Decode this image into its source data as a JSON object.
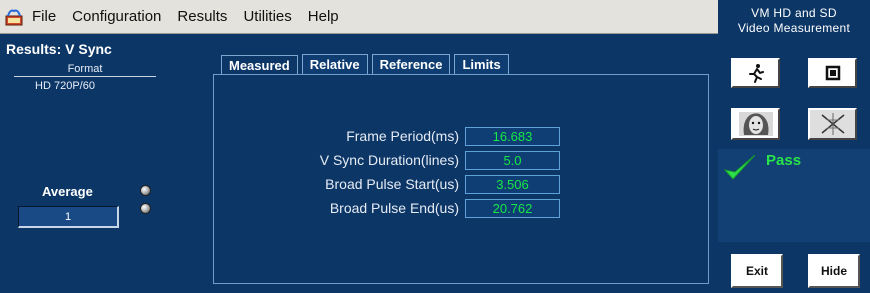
{
  "menu": {
    "app_icon": "application-icon",
    "items": [
      "File",
      "Configuration",
      "Results",
      "Utilities",
      "Help"
    ]
  },
  "app_title": {
    "line1": "VM HD and SD",
    "line2": "Video Measurement"
  },
  "left": {
    "title": "Results: V Sync",
    "format_label": "Format",
    "format_value": "HD 720P/60",
    "average_label": "Average",
    "average_value": "1"
  },
  "tabs": [
    {
      "label": "Measured",
      "active": true
    },
    {
      "label": "Relative",
      "active": false
    },
    {
      "label": "Reference",
      "active": false
    },
    {
      "label": "Limits",
      "active": false
    }
  ],
  "measurements": [
    {
      "label": "Frame Period(ms)",
      "value": "16.683"
    },
    {
      "label": "V Sync Duration(lines)",
      "value": "5.0"
    },
    {
      "label": "Broad Pulse Start(us)",
      "value": "3.506"
    },
    {
      "label": "Broad Pulse End(us)",
      "value": "20.762"
    }
  ],
  "right_buttons": {
    "run_icon": "running-man-icon",
    "stop_icon": "stop-square-icon",
    "face_icon": "face-image-icon",
    "pattern_icon": "cross-pattern-icon"
  },
  "status": {
    "icon": "checkmark-icon",
    "label": "Pass"
  },
  "footer": {
    "exit_label": "Exit",
    "hide_label": "Hide"
  },
  "colors": {
    "background": "#0c3666",
    "menubar": "#e4e2dc",
    "value_text": "#17e845",
    "pass": "#29e44a"
  }
}
